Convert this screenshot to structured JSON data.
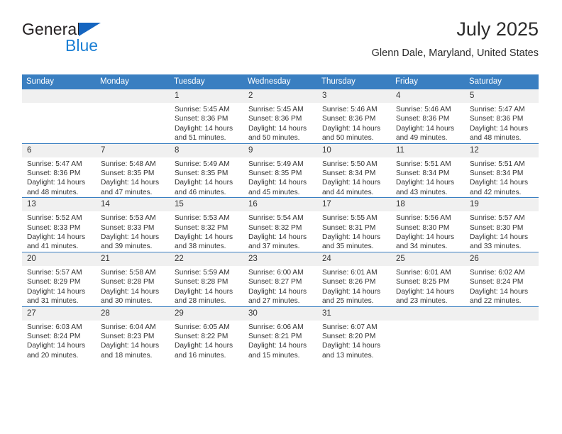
{
  "brand": {
    "name_part1": "General",
    "name_part2": "Blue",
    "triangle_color": "#1565c0",
    "blue_color": "#1b7fd4"
  },
  "header": {
    "title": "July 2025",
    "subtitle": "Glenn Dale, Maryland, United States"
  },
  "theme": {
    "header_background": "#3a7fc1",
    "header_text": "#ffffff",
    "daynum_background": "#f0f0f0",
    "row_border": "#3a7fc1",
    "body_text": "#333333"
  },
  "weekday_headers": [
    "Sunday",
    "Monday",
    "Tuesday",
    "Wednesday",
    "Thursday",
    "Friday",
    "Saturday"
  ],
  "labels": {
    "sunrise_prefix": "Sunrise:",
    "sunset_prefix": "Sunset:",
    "daylight_prefix": "Daylight:"
  },
  "weeks": [
    [
      {
        "day": "",
        "blank": true,
        "sunrise": "",
        "sunset": "",
        "daylight": ""
      },
      {
        "day": "",
        "blank": true,
        "sunrise": "",
        "sunset": "",
        "daylight": ""
      },
      {
        "day": "1",
        "sunrise": "Sunrise: 5:45 AM",
        "sunset": "Sunset: 8:36 PM",
        "daylight": "Daylight: 14 hours and 51 minutes."
      },
      {
        "day": "2",
        "sunrise": "Sunrise: 5:45 AM",
        "sunset": "Sunset: 8:36 PM",
        "daylight": "Daylight: 14 hours and 50 minutes."
      },
      {
        "day": "3",
        "sunrise": "Sunrise: 5:46 AM",
        "sunset": "Sunset: 8:36 PM",
        "daylight": "Daylight: 14 hours and 50 minutes."
      },
      {
        "day": "4",
        "sunrise": "Sunrise: 5:46 AM",
        "sunset": "Sunset: 8:36 PM",
        "daylight": "Daylight: 14 hours and 49 minutes."
      },
      {
        "day": "5",
        "sunrise": "Sunrise: 5:47 AM",
        "sunset": "Sunset: 8:36 PM",
        "daylight": "Daylight: 14 hours and 48 minutes."
      }
    ],
    [
      {
        "day": "6",
        "sunrise": "Sunrise: 5:47 AM",
        "sunset": "Sunset: 8:36 PM",
        "daylight": "Daylight: 14 hours and 48 minutes."
      },
      {
        "day": "7",
        "sunrise": "Sunrise: 5:48 AM",
        "sunset": "Sunset: 8:35 PM",
        "daylight": "Daylight: 14 hours and 47 minutes."
      },
      {
        "day": "8",
        "sunrise": "Sunrise: 5:49 AM",
        "sunset": "Sunset: 8:35 PM",
        "daylight": "Daylight: 14 hours and 46 minutes."
      },
      {
        "day": "9",
        "sunrise": "Sunrise: 5:49 AM",
        "sunset": "Sunset: 8:35 PM",
        "daylight": "Daylight: 14 hours and 45 minutes."
      },
      {
        "day": "10",
        "sunrise": "Sunrise: 5:50 AM",
        "sunset": "Sunset: 8:34 PM",
        "daylight": "Daylight: 14 hours and 44 minutes."
      },
      {
        "day": "11",
        "sunrise": "Sunrise: 5:51 AM",
        "sunset": "Sunset: 8:34 PM",
        "daylight": "Daylight: 14 hours and 43 minutes."
      },
      {
        "day": "12",
        "sunrise": "Sunrise: 5:51 AM",
        "sunset": "Sunset: 8:34 PM",
        "daylight": "Daylight: 14 hours and 42 minutes."
      }
    ],
    [
      {
        "day": "13",
        "sunrise": "Sunrise: 5:52 AM",
        "sunset": "Sunset: 8:33 PM",
        "daylight": "Daylight: 14 hours and 41 minutes."
      },
      {
        "day": "14",
        "sunrise": "Sunrise: 5:53 AM",
        "sunset": "Sunset: 8:33 PM",
        "daylight": "Daylight: 14 hours and 39 minutes."
      },
      {
        "day": "15",
        "sunrise": "Sunrise: 5:53 AM",
        "sunset": "Sunset: 8:32 PM",
        "daylight": "Daylight: 14 hours and 38 minutes."
      },
      {
        "day": "16",
        "sunrise": "Sunrise: 5:54 AM",
        "sunset": "Sunset: 8:32 PM",
        "daylight": "Daylight: 14 hours and 37 minutes."
      },
      {
        "day": "17",
        "sunrise": "Sunrise: 5:55 AM",
        "sunset": "Sunset: 8:31 PM",
        "daylight": "Daylight: 14 hours and 35 minutes."
      },
      {
        "day": "18",
        "sunrise": "Sunrise: 5:56 AM",
        "sunset": "Sunset: 8:30 PM",
        "daylight": "Daylight: 14 hours and 34 minutes."
      },
      {
        "day": "19",
        "sunrise": "Sunrise: 5:57 AM",
        "sunset": "Sunset: 8:30 PM",
        "daylight": "Daylight: 14 hours and 33 minutes."
      }
    ],
    [
      {
        "day": "20",
        "sunrise": "Sunrise: 5:57 AM",
        "sunset": "Sunset: 8:29 PM",
        "daylight": "Daylight: 14 hours and 31 minutes."
      },
      {
        "day": "21",
        "sunrise": "Sunrise: 5:58 AM",
        "sunset": "Sunset: 8:28 PM",
        "daylight": "Daylight: 14 hours and 30 minutes."
      },
      {
        "day": "22",
        "sunrise": "Sunrise: 5:59 AM",
        "sunset": "Sunset: 8:28 PM",
        "daylight": "Daylight: 14 hours and 28 minutes."
      },
      {
        "day": "23",
        "sunrise": "Sunrise: 6:00 AM",
        "sunset": "Sunset: 8:27 PM",
        "daylight": "Daylight: 14 hours and 27 minutes."
      },
      {
        "day": "24",
        "sunrise": "Sunrise: 6:01 AM",
        "sunset": "Sunset: 8:26 PM",
        "daylight": "Daylight: 14 hours and 25 minutes."
      },
      {
        "day": "25",
        "sunrise": "Sunrise: 6:01 AM",
        "sunset": "Sunset: 8:25 PM",
        "daylight": "Daylight: 14 hours and 23 minutes."
      },
      {
        "day": "26",
        "sunrise": "Sunrise: 6:02 AM",
        "sunset": "Sunset: 8:24 PM",
        "daylight": "Daylight: 14 hours and 22 minutes."
      }
    ],
    [
      {
        "day": "27",
        "sunrise": "Sunrise: 6:03 AM",
        "sunset": "Sunset: 8:24 PM",
        "daylight": "Daylight: 14 hours and 20 minutes."
      },
      {
        "day": "28",
        "sunrise": "Sunrise: 6:04 AM",
        "sunset": "Sunset: 8:23 PM",
        "daylight": "Daylight: 14 hours and 18 minutes."
      },
      {
        "day": "29",
        "sunrise": "Sunrise: 6:05 AM",
        "sunset": "Sunset: 8:22 PM",
        "daylight": "Daylight: 14 hours and 16 minutes."
      },
      {
        "day": "30",
        "sunrise": "Sunrise: 6:06 AM",
        "sunset": "Sunset: 8:21 PM",
        "daylight": "Daylight: 14 hours and 15 minutes."
      },
      {
        "day": "31",
        "sunrise": "Sunrise: 6:07 AM",
        "sunset": "Sunset: 8:20 PM",
        "daylight": "Daylight: 14 hours and 13 minutes."
      },
      {
        "day": "",
        "blank": true,
        "sunrise": "",
        "sunset": "",
        "daylight": ""
      },
      {
        "day": "",
        "blank": true,
        "sunrise": "",
        "sunset": "",
        "daylight": ""
      }
    ]
  ]
}
